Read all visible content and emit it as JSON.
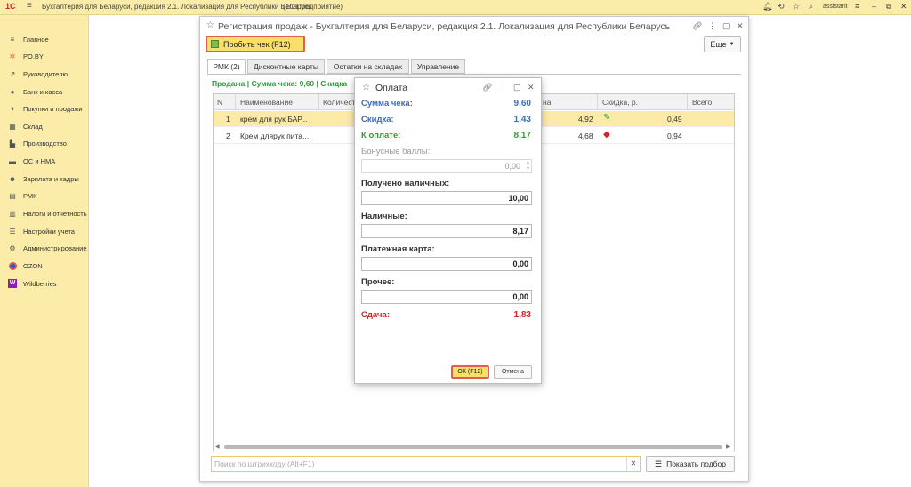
{
  "app": {
    "logo": "1С",
    "title": "Бухгалтерия для Беларуси, редакция 2.1. Локализация для Республики Беларусь",
    "platform": "(1С:Предприятие)",
    "user": "assistant"
  },
  "sidebar": {
    "items": [
      {
        "label": "Главное",
        "icon": "menu-icon"
      },
      {
        "label": "PO.BY",
        "icon": "star-icon"
      },
      {
        "label": "Руководителю",
        "icon": "chart-icon"
      },
      {
        "label": "Банк и касса",
        "icon": "coin-icon"
      },
      {
        "label": "Покупки и продажи",
        "icon": "cart-icon"
      },
      {
        "label": "Склад",
        "icon": "warehouse-icon"
      },
      {
        "label": "Производство",
        "icon": "factory-icon"
      },
      {
        "label": "ОС и НМА",
        "icon": "truck-icon"
      },
      {
        "label": "Зарплата и кадры",
        "icon": "people-icon"
      },
      {
        "label": "РМК",
        "icon": "register-icon"
      },
      {
        "label": "Налоги и отчетность",
        "icon": "reports-icon"
      },
      {
        "label": "Настройки учета",
        "icon": "settings-list-icon"
      },
      {
        "label": "Администрирование",
        "icon": "gear-icon"
      },
      {
        "label": "OZON",
        "icon": "ozon-icon"
      },
      {
        "label": "Wildberries",
        "icon": "wildberries-icon"
      }
    ]
  },
  "window": {
    "title": "Регистрация продаж - Бухгалтерия для Беларуси, редакция 2.1. Локализация для Республики Беларусь",
    "print_button": "Пробить чек (F12)",
    "more_button": "Еще",
    "tabs": [
      "РМК (2)",
      "Дисконтные карты",
      "Остатки на складах",
      "Управление"
    ],
    "sale_line": "Продажа | Сумма чека: 9,60 | Скидка",
    "grid": {
      "headers": [
        "N",
        "Наименование",
        "Количест",
        "на",
        "Скидка, р.",
        "Всего"
      ],
      "rows": [
        {
          "n": "1",
          "name": "крем для рук БАР...",
          "price": "4,92",
          "discount": "0,49"
        },
        {
          "n": "2",
          "name": "Крем длярук пита...",
          "price": "4,68",
          "discount": "0,94"
        }
      ]
    },
    "barcode_placeholder": "Поиск по штрихкоду (Alt+F1)",
    "show_button": "Показать подбор"
  },
  "payment": {
    "title": "Оплата",
    "sum_label": "Сумма чека:",
    "sum_value": "9,60",
    "discount_label": "Скидка:",
    "discount_value": "1,43",
    "topay_label": "К оплате:",
    "topay_value": "8,17",
    "bonus_label": "Бонусные баллы:",
    "bonus_value": "0,00",
    "received_label": "Получено наличных:",
    "received_value": "10,00",
    "cash_label": "Наличные:",
    "cash_value": "8,17",
    "card_label": "Платежная карта:",
    "card_value": "0,00",
    "other_label": "Прочее:",
    "other_value": "0,00",
    "change_label": "Сдача:",
    "change_value": "1,83",
    "ok_button": "ОК (F12)",
    "cancel_button": "Отмена"
  },
  "colors": {
    "accent_yellow": "#fbeda9",
    "button_yellow": "#f7e06a",
    "highlight_red": "#e06050",
    "blue_text": "#3d6db5",
    "green_text": "#2e9a3c",
    "red_text": "#d02525"
  }
}
